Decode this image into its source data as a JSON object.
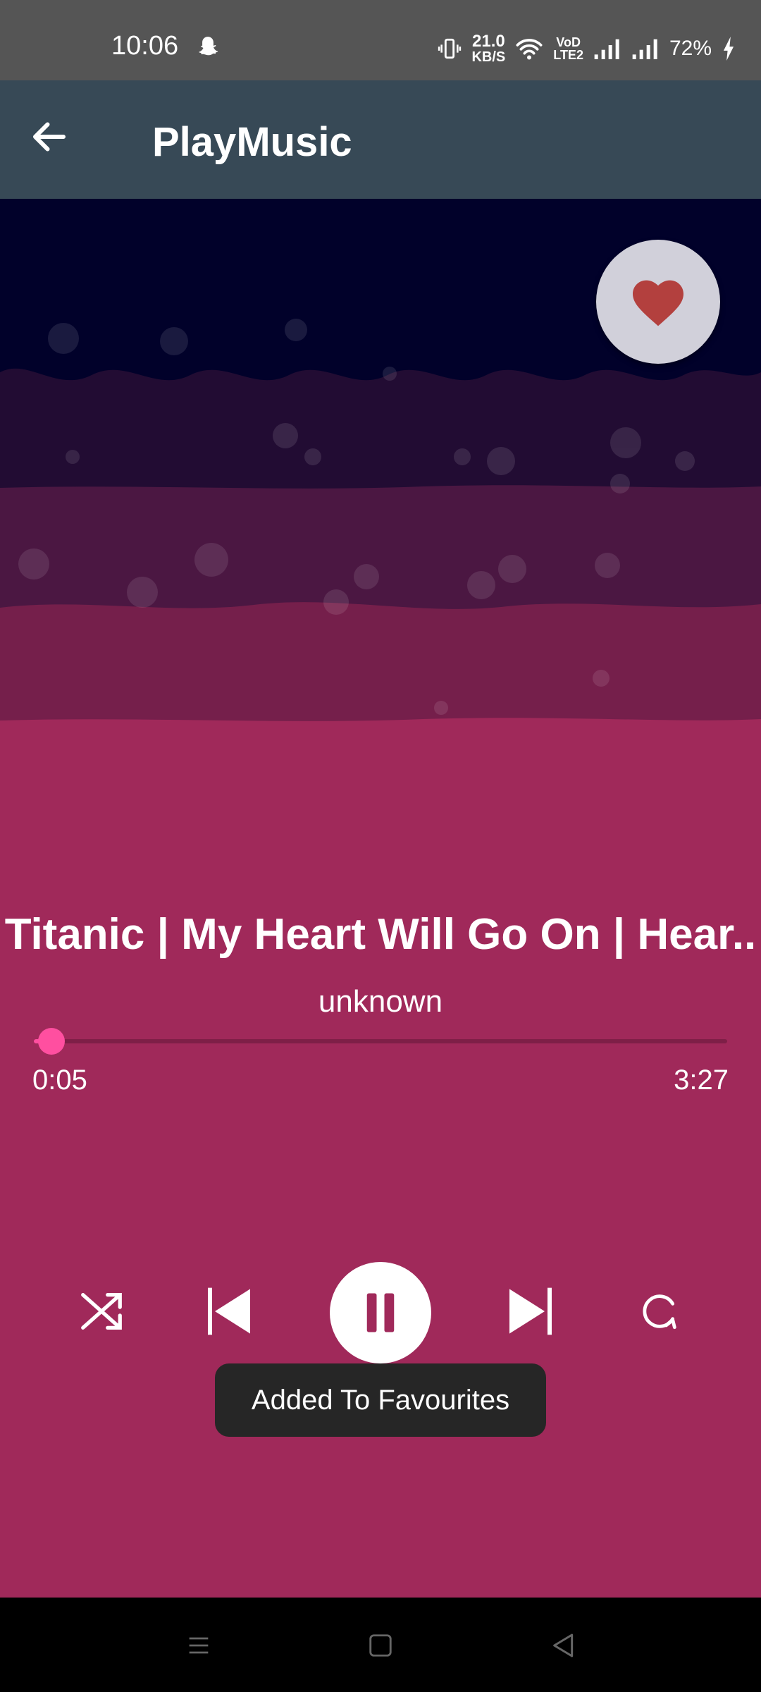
{
  "status_bar": {
    "time": "10:06",
    "net_speed_value": "21.0",
    "net_speed_unit": "KB/S",
    "volte_top": "VoD",
    "volte_bottom": "LTE2",
    "battery": "72%"
  },
  "app_bar": {
    "title": "PlayMusic"
  },
  "player": {
    "song_title": "Titanic | My Heart Will Go On | Hear..",
    "artist": "unknown",
    "current_time": "0:05",
    "total_time": "3:27",
    "progress_fraction": 0.025,
    "favourite": true
  },
  "controls": [
    "shuffle",
    "previous",
    "pause",
    "next",
    "repeat"
  ],
  "toast": {
    "text": "Added To Favourites"
  },
  "colors": {
    "accent": "#ff4fa0",
    "heart": "#b3403e",
    "app_bar": "#374956",
    "background": "#a0295a"
  }
}
